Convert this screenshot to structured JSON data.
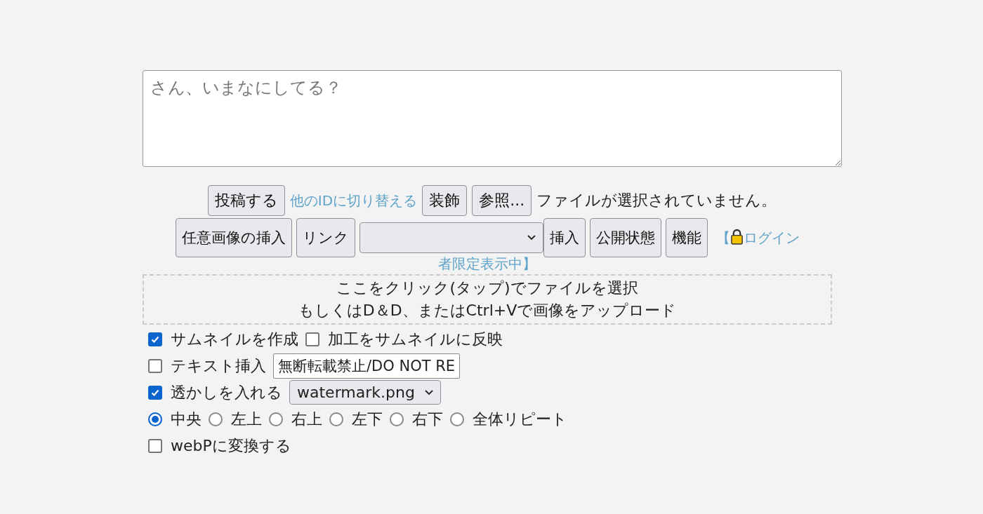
{
  "post_box": {
    "placeholder": "さん、いまなにしてる？"
  },
  "row1": [
    {
      "kind": "button",
      "label": "投稿する"
    },
    {
      "kind": "link",
      "label": "他のIDに切り替える"
    },
    {
      "kind": "button",
      "label": "装飾"
    },
    {
      "kind": "button",
      "label": "参照..."
    },
    {
      "kind": "text",
      "label": "ファイルが選択されていません。"
    }
  ],
  "row2": [
    {
      "kind": "button",
      "label": "任意画像の挿入"
    },
    {
      "kind": "button",
      "label": "リンク"
    },
    {
      "kind": "select"
    },
    {
      "kind": "button",
      "label": "挿入"
    },
    {
      "kind": "button",
      "label": "公開状態"
    },
    {
      "kind": "button",
      "label": "機能"
    }
  ],
  "visibility_link": {
    "before": "【",
    "line1": "ログイン",
    "line2": "者限定表示中】"
  },
  "drop_zone": [
    "ここをクリック(タップ)でファイルを選択",
    "もしくはD＆D、またはCtrl+Vで画像をアップロード"
  ],
  "options": [
    {
      "items": [
        {
          "kind": "checkbox",
          "label": "サムネイルを作成",
          "checked": true
        },
        {
          "kind": "checkbox",
          "label": "加工をサムネイルに反映",
          "checked": false
        }
      ]
    },
    {
      "items": [
        {
          "kind": "checkbox",
          "label": "テキスト挿入",
          "checked": false
        },
        {
          "kind": "input",
          "value": "無断転載禁止/DO NOT RE"
        }
      ]
    },
    {
      "items": [
        {
          "kind": "checkbox",
          "label": "透かしを入れる",
          "checked": true
        },
        {
          "kind": "select",
          "label": "watermark.png"
        }
      ]
    },
    {
      "items": [
        {
          "kind": "radio",
          "label": "中央",
          "selected": true
        },
        {
          "kind": "radio",
          "label": "左上",
          "selected": false
        },
        {
          "kind": "radio",
          "label": "右上",
          "selected": false
        },
        {
          "kind": "radio",
          "label": "左下",
          "selected": false
        },
        {
          "kind": "radio",
          "label": "右下",
          "selected": false
        },
        {
          "kind": "radio",
          "label": "全体リピート",
          "selected": false
        }
      ]
    },
    {
      "items": [
        {
          "kind": "checkbox",
          "label": "webPに変換する",
          "checked": false
        }
      ]
    }
  ]
}
